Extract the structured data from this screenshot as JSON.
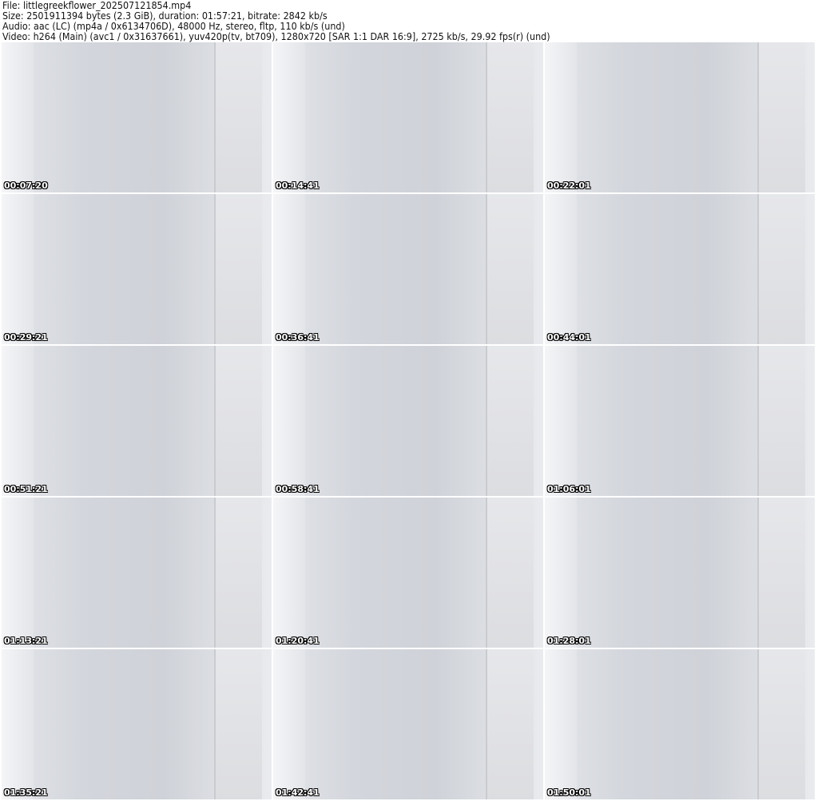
{
  "header": {
    "file": "File: littlegreekflower_202507121854.mp4",
    "size": "Size: 2501911394 bytes (2.3 GiB), duration: 01:57:21, bitrate: 2842 kb/s",
    "audio": "Audio: aac (LC) (mp4a / 0x6134706D), 48000 Hz, stereo, fltp, 110 kb/s (und)",
    "video": "Video: h264 (Main) (avc1 / 0x31637661), yuv420p(tv, bt709), 1280x720 [SAR 1:1 DAR 16:9], 2725 kb/s, 29.92 fps(r) (und)"
  },
  "thumbnails": [
    {
      "timestamp": "00:07:20"
    },
    {
      "timestamp": "00:14:41"
    },
    {
      "timestamp": "00:22:01"
    },
    {
      "timestamp": "00:29:21"
    },
    {
      "timestamp": "00:36:41"
    },
    {
      "timestamp": "00:44:01"
    },
    {
      "timestamp": "00:51:21"
    },
    {
      "timestamp": "00:58:41"
    },
    {
      "timestamp": "01:06:01"
    },
    {
      "timestamp": "01:13:21"
    },
    {
      "timestamp": "01:20:41"
    },
    {
      "timestamp": "01:28:01"
    },
    {
      "timestamp": "01:35:21"
    },
    {
      "timestamp": "01:42:41"
    },
    {
      "timestamp": "01:50:01"
    }
  ]
}
